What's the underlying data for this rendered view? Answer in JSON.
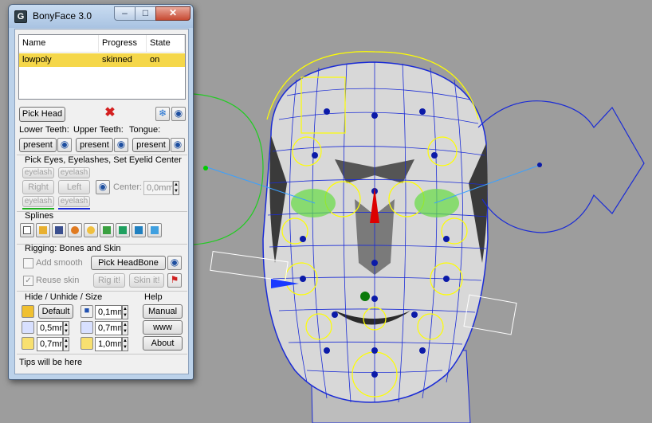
{
  "window": {
    "title": "BonyFace 3.0",
    "icon": "G"
  },
  "table": {
    "headers": [
      "Name",
      "Progress",
      "State"
    ],
    "rows": [
      {
        "name": "lowpoly",
        "progress": "skinned",
        "state": "on"
      }
    ]
  },
  "pick_head": {
    "label": "Pick Head"
  },
  "teeth": {
    "lower_label": "Lower Teeth:",
    "upper_label": "Upper Teeth:",
    "tongue_label": "Tongue:",
    "lower_value": "present",
    "upper_value": "present",
    "tongue_value": "present"
  },
  "eyes": {
    "title": "Pick Eyes, Eyelashes, Set Eyelid Center",
    "eyelash_left_top": "eyelash",
    "eyelash_right_top": "eyelash",
    "right_label": "Right",
    "left_label": "Left",
    "eyelash_left_bottom": "eyelash",
    "eyelash_right_bottom": "eyelash",
    "center_label": "Center:",
    "center_value": "0,0mm"
  },
  "splines": {
    "title": "Splines"
  },
  "rigging": {
    "title": "Rigging: Bones and Skin",
    "add_smooth_label": "Add smooth",
    "pick_headbone_label": "Pick HeadBone",
    "reuse_skin_label": "Reuse skin",
    "rig_it_label": "Rig it!",
    "skin_it_label": "Skin it!"
  },
  "hide": {
    "title": "Hide / Unhide / Size",
    "default_label": "Default",
    "size1": "0,1mm",
    "size2": "0,5mm",
    "size3": "0,7mm",
    "size4": "0,7mm",
    "size5": "1,0mm"
  },
  "help": {
    "title": "Help",
    "manual_label": "Manual",
    "www_label": "www",
    "about_label": "About"
  },
  "tips": {
    "text": "Tips will be here"
  },
  "colors": {
    "selection": "#f5d74a",
    "viewport": "#9d9d9d",
    "mesh": "#1a2bd6",
    "bone": "#ffff00"
  }
}
